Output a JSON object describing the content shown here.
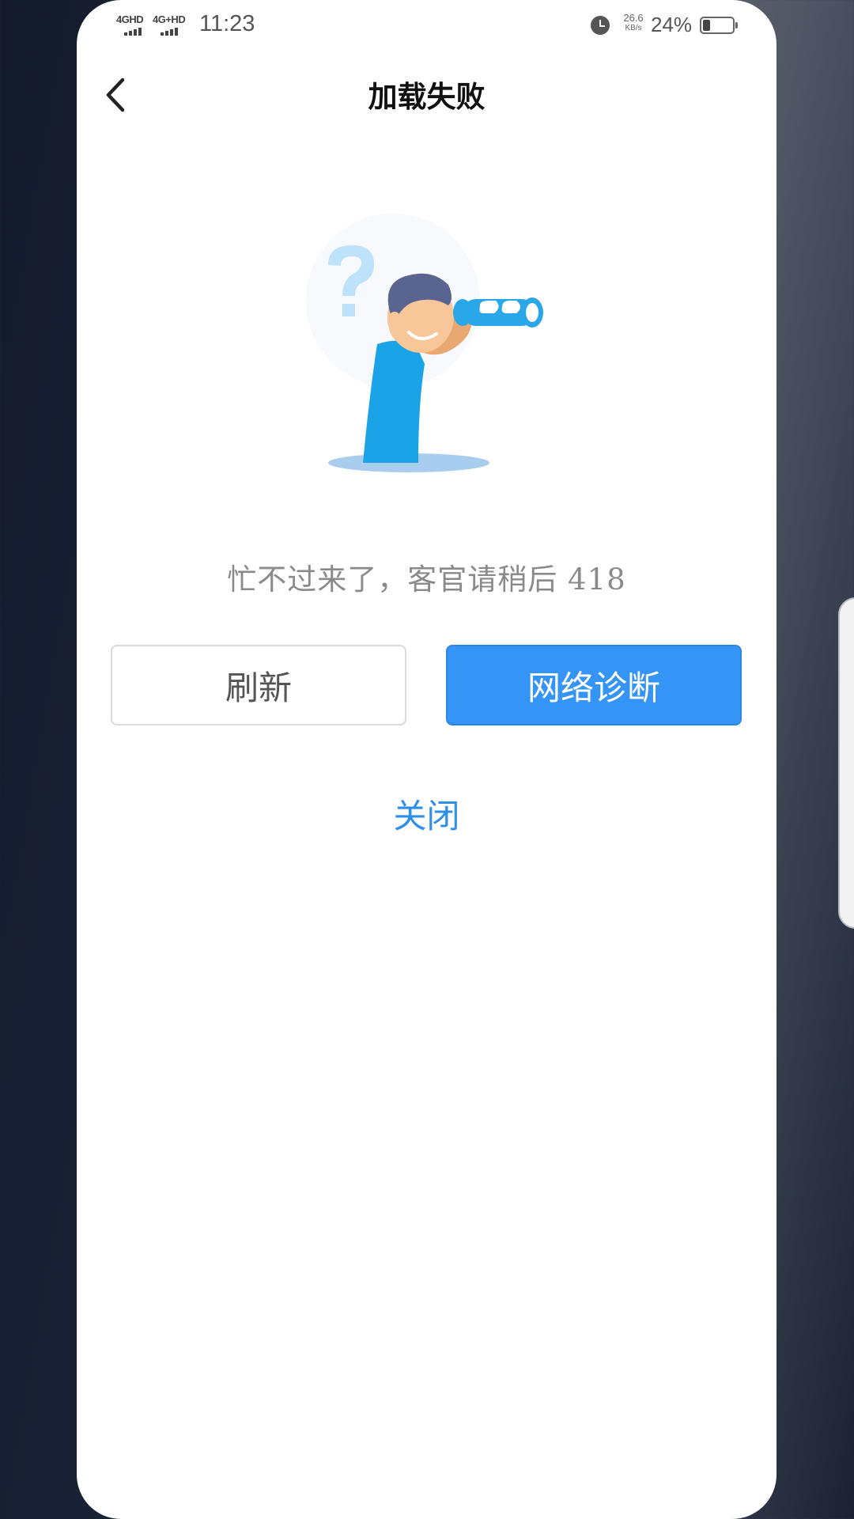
{
  "status_bar": {
    "signal_1_label": "4GHD",
    "signal_2_label": "4G+HD",
    "time": "11:23",
    "net_speed_value": "26.6",
    "net_speed_unit": "KB/s",
    "battery_percent_text": "24%",
    "battery_level": 0.24,
    "alarm_icon": "alarm-clock-icon"
  },
  "header": {
    "back_icon": "chevron-left-icon",
    "title": "加载失败"
  },
  "illustration": {
    "icon": "person-with-binoculars-question-icon"
  },
  "error": {
    "message": "忙不过来了，客官请稍后 418"
  },
  "actions": {
    "refresh_label": "刷新",
    "diagnose_label": "网络诊断",
    "close_label": "关闭"
  },
  "colors": {
    "primary": "#3595f7",
    "link": "#2f8fe8",
    "message_text": "#8a8a8a",
    "title_text": "#111111"
  }
}
